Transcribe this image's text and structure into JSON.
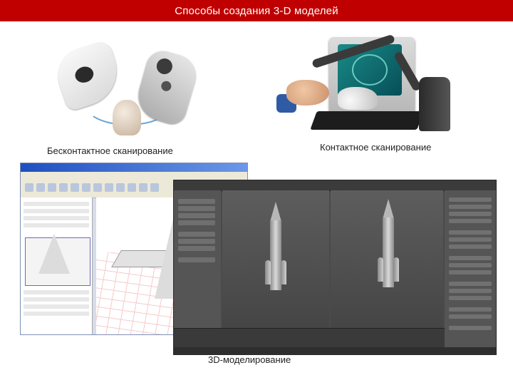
{
  "header": {
    "title": "Способы создания 3-D моделей"
  },
  "captions": {
    "noncontact": "Бесконтактное сканирование",
    "contact": "Контактное сканирование",
    "modeling": "3D-моделирование"
  },
  "colors": {
    "title_bar": "#c00000",
    "background": "#ffffff"
  }
}
